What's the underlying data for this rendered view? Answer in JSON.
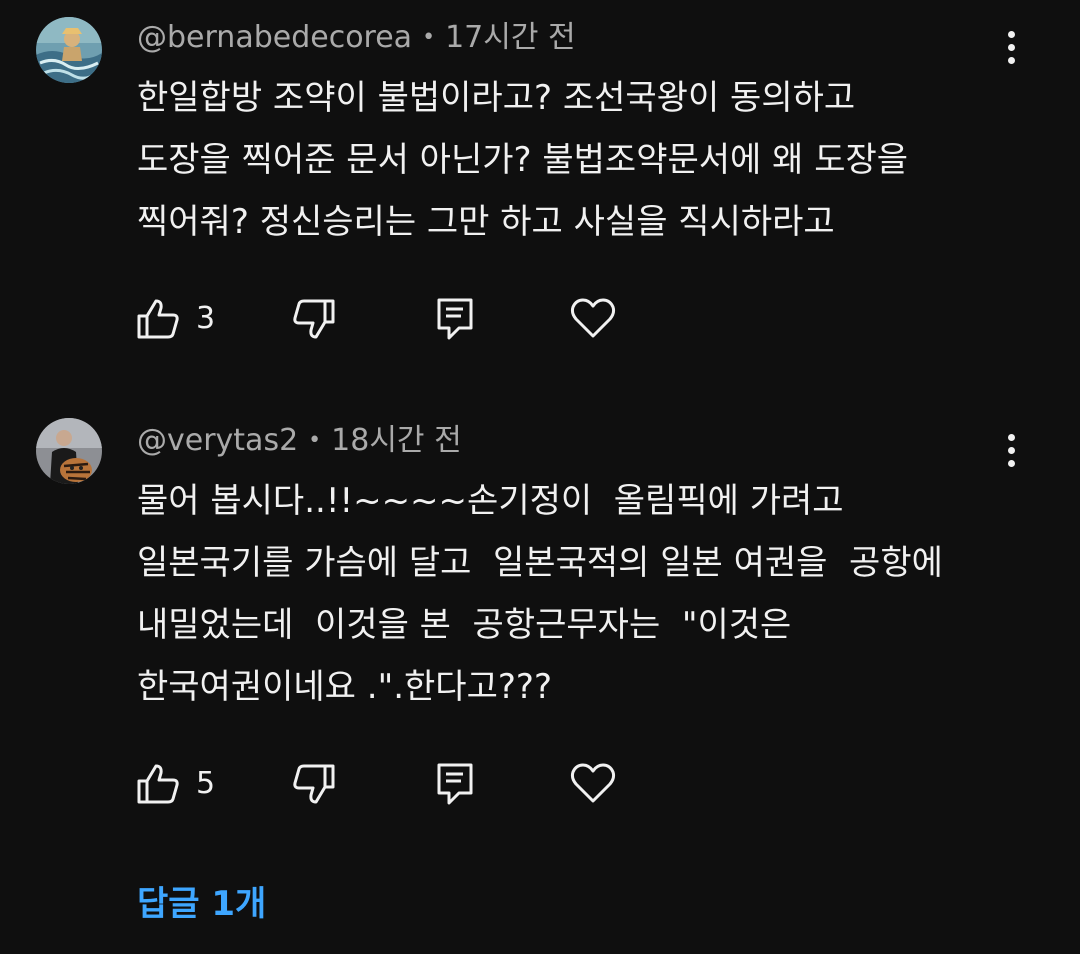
{
  "colors": {
    "background": "#0f0f0f",
    "text_primary": "#f1f1f1",
    "text_secondary": "#aaaaaa",
    "link_accent": "#3ea6ff"
  },
  "comments": [
    {
      "author": "@bernabedecorea",
      "separator": "•",
      "time": "17시간 전",
      "text_lines": [
        "한일합방 조약이 불법이라고? 조선국왕이 동의하고",
        "도장을 찍어준 문서 아닌가? 불법조약문서에 왜 도장을",
        "찍어줘? 정신승리는 그만 하고 사실을 직시하라고"
      ],
      "like_count": "3",
      "icons": {
        "avatar": "avatar-image",
        "more": "more-vert-icon",
        "like": "thumbs-up-icon",
        "dislike": "thumbs-down-icon",
        "reply": "reply-comment-icon",
        "heart": "heart-icon"
      }
    },
    {
      "author": "@verytas2",
      "separator": "•",
      "time": "18시간 전",
      "text_lines": [
        "물어 봅시다..!!~~~~손기정이  올림픽에 가려고",
        "일본국기를 가슴에 달고  일본국적의 일본 여권을  공항에",
        "내밀었는데  이것을 본  공항근무자는  \"이것은",
        "한국여권이네요 .\".한다고???"
      ],
      "like_count": "5",
      "replies_label": "답글 1개",
      "icons": {
        "avatar": "avatar-image",
        "more": "more-vert-icon",
        "like": "thumbs-up-icon",
        "dislike": "thumbs-down-icon",
        "reply": "reply-comment-icon",
        "heart": "heart-icon"
      }
    }
  ]
}
